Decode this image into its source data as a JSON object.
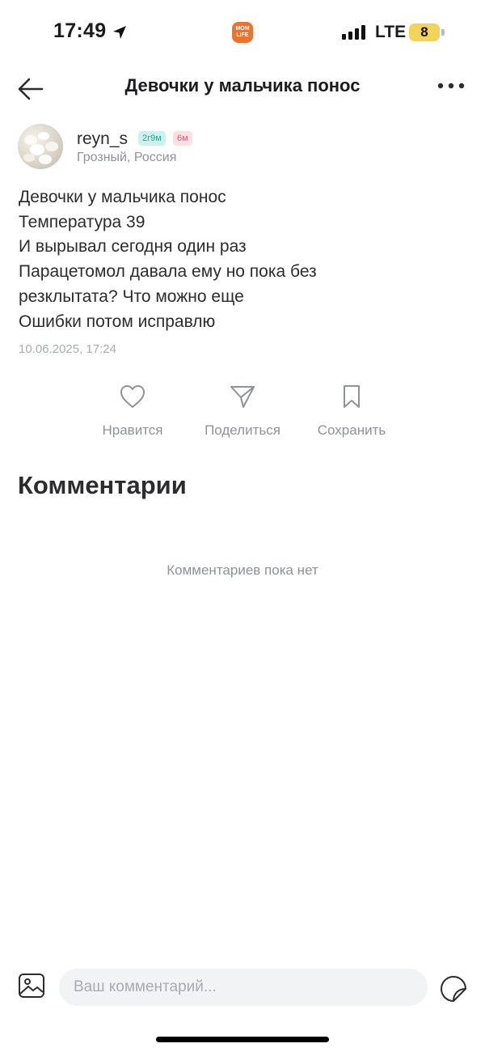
{
  "status_bar": {
    "time": "17:49",
    "network": "LTE",
    "battery": "8",
    "app_badge": "MOM LIFE"
  },
  "header": {
    "title": "Девочки у мальчика понос"
  },
  "author": {
    "username": "reyn_s",
    "badges": [
      "2г9м",
      "6м"
    ],
    "location": "Грозный, Россия"
  },
  "post": {
    "lines": [
      "Девочки у мальчика понос",
      "Температура 39",
      "И вырывал сегодня один раз",
      "Парацетомол давала ему но пока без",
      "резклытата? Что можно еще",
      "Ошибки потом исправлю"
    ],
    "date": "10.06.2025, 17:24"
  },
  "actions": {
    "like": "Нравится",
    "share": "Поделиться",
    "save": "Сохранить"
  },
  "comments": {
    "title": "Комментарии",
    "empty": "Комментариев пока нет"
  },
  "composer": {
    "placeholder": "Ваш комментарий..."
  },
  "icons": {
    "back": "arrow-left-icon",
    "more": "more-dots-icon",
    "like": "heart-icon",
    "share": "paper-plane-icon",
    "save": "bookmark-icon",
    "image": "image-icon",
    "sticker": "sticker-icon"
  }
}
